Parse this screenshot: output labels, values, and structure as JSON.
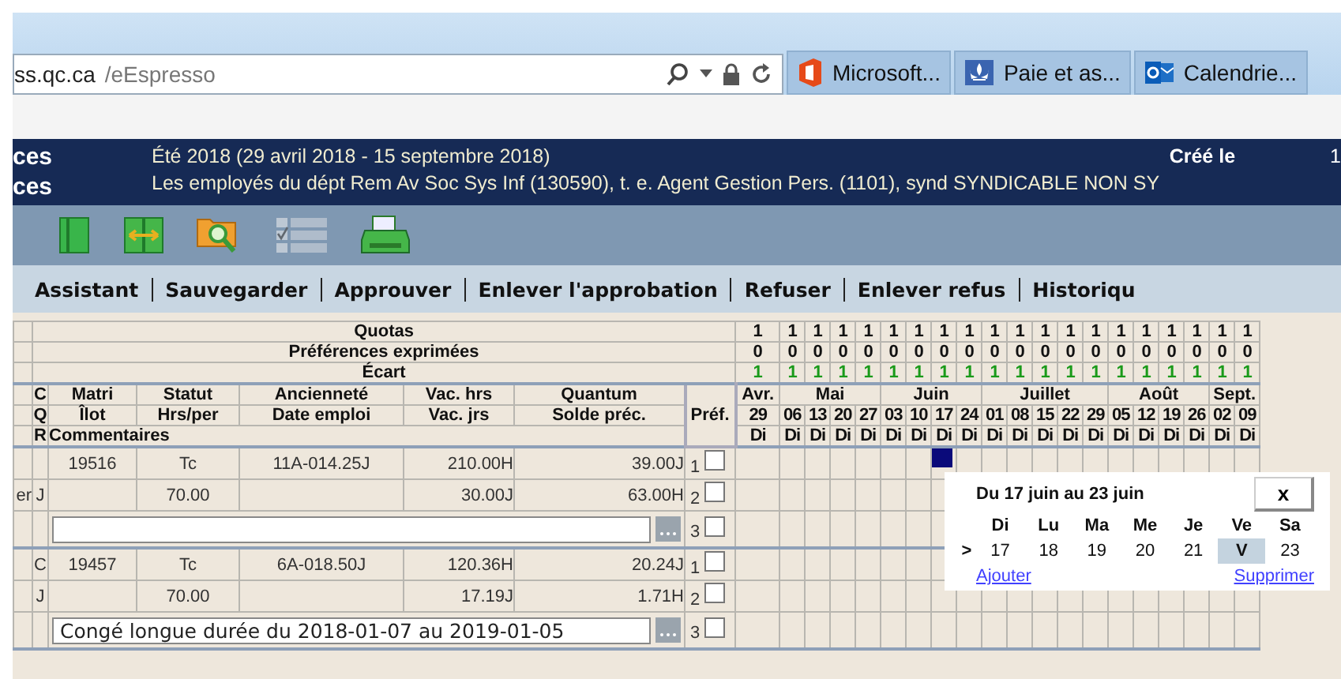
{
  "browser": {
    "address_host": "ss.qc.ca",
    "address_path": "/eEspresso",
    "tabs": [
      {
        "title": "Microsoft...",
        "kind": "office"
      },
      {
        "title": "Paie et as...",
        "kind": "fleur"
      },
      {
        "title": "Calendrie...",
        "kind": "outlook"
      }
    ]
  },
  "header": {
    "left_lines": [
      "ces",
      "ces"
    ],
    "period": "Été 2018 (29 avril 2018 - 15 septembre 2018)",
    "created_label": "Créé le",
    "created_value": "1",
    "description": "Les employés du dépt Rem Av Soc Sys Inf (130590), t. e. Agent Gestion Pers. (1101), synd SYNDICABLE NON SY"
  },
  "toolbar": [
    {
      "kind": "book",
      "disabled": false
    },
    {
      "kind": "split",
      "disabled": false
    },
    {
      "kind": "search-folder",
      "disabled": false
    },
    {
      "kind": "checklist",
      "disabled": true
    },
    {
      "kind": "printer",
      "disabled": false
    }
  ],
  "menu": [
    "Assistant",
    "Sauvegarder",
    "Approuver",
    "Enlever l'approbation",
    "Refuser",
    "Enlever refus",
    "Historiqu"
  ],
  "summary_labels": [
    "Quotas",
    "Préférences exprimées",
    "Écart"
  ],
  "columns": {
    "row1": [
      "C",
      "Matri",
      "Statut",
      "Ancienneté",
      "Vac. hrs",
      "Quantum"
    ],
    "row2": [
      "Q",
      "Îlot",
      "Hrs/per",
      "Date emploi",
      "Vac. jrs",
      "Solde préc."
    ],
    "row3": [
      "R",
      "Commentaires"
    ],
    "pref": "Préf."
  },
  "months": [
    {
      "name": "Avr.",
      "weeks": [
        {
          "date": "29",
          "day": "Di",
          "quota": "1",
          "preferences": "0",
          "ecart": "1"
        }
      ]
    },
    {
      "name": "Mai",
      "weeks": [
        {
          "date": "06",
          "day": "Di",
          "quota": "1",
          "preferences": "0",
          "ecart": "1"
        },
        {
          "date": "13",
          "day": "Di",
          "quota": "1",
          "preferences": "0",
          "ecart": "1"
        },
        {
          "date": "20",
          "day": "Di",
          "quota": "1",
          "preferences": "0",
          "ecart": "1"
        },
        {
          "date": "27",
          "day": "Di",
          "quota": "1",
          "preferences": "0",
          "ecart": "1"
        }
      ]
    },
    {
      "name": "Juin",
      "weeks": [
        {
          "date": "03",
          "day": "Di",
          "quota": "1",
          "preferences": "0",
          "ecart": "1"
        },
        {
          "date": "10",
          "day": "Di",
          "quota": "1",
          "preferences": "0",
          "ecart": "1"
        },
        {
          "date": "17",
          "day": "Di",
          "quota": "1",
          "preferences": "0",
          "ecart": "1"
        },
        {
          "date": "24",
          "day": "Di",
          "quota": "1",
          "preferences": "0",
          "ecart": "1"
        }
      ]
    },
    {
      "name": "Juillet",
      "weeks": [
        {
          "date": "01",
          "day": "Di",
          "quota": "1",
          "preferences": "0",
          "ecart": "1"
        },
        {
          "date": "08",
          "day": "Di",
          "quota": "1",
          "preferences": "0",
          "ecart": "1"
        },
        {
          "date": "15",
          "day": "Di",
          "quota": "1",
          "preferences": "0",
          "ecart": "1"
        },
        {
          "date": "22",
          "day": "Di",
          "quota": "1",
          "preferences": "0",
          "ecart": "1"
        },
        {
          "date": "29",
          "day": "Di",
          "quota": "1",
          "preferences": "0",
          "ecart": "1"
        }
      ]
    },
    {
      "name": "Août",
      "weeks": [
        {
          "date": "05",
          "day": "Di",
          "quota": "1",
          "preferences": "0",
          "ecart": "1"
        },
        {
          "date": "12",
          "day": "Di",
          "quota": "1",
          "preferences": "0",
          "ecart": "1"
        },
        {
          "date": "19",
          "day": "Di",
          "quota": "1",
          "preferences": "0",
          "ecart": "1"
        },
        {
          "date": "26",
          "day": "Di",
          "quota": "1",
          "preferences": "0",
          "ecart": "1"
        }
      ]
    },
    {
      "name": "Sept.",
      "weeks": [
        {
          "date": "02",
          "day": "Di",
          "quota": "1",
          "preferences": "0",
          "ecart": "1"
        },
        {
          "date": "09",
          "day": "Di",
          "quota": "1",
          "preferences": "0",
          "ecart": "1"
        }
      ]
    }
  ],
  "employees": [
    {
      "rows": [
        {
          "matri": "19516",
          "statut": "Tc",
          "anciennete": "11A-014.25J",
          "vac": "210.00H",
          "quantum": "39.00J"
        },
        {
          "column_1": "er",
          "code": "J",
          "statut": "70.00",
          "vac": "30.00J",
          "quantum": "63.00H"
        }
      ],
      "prefs": [
        {
          "label": "1",
          "checked": false
        },
        {
          "label": "2",
          "checked": false
        },
        {
          "label": "3",
          "checked": false
        }
      ],
      "weeks_marked": [
        false,
        false,
        false,
        false,
        false,
        false,
        false,
        true,
        false,
        false,
        false,
        false,
        false,
        false,
        false,
        false,
        false,
        false,
        false,
        false
      ]
    },
    {
      "rows": [
        {
          "code": "C",
          "matri": "19457",
          "statut": "Tc",
          "anciennete": "6A-018.50J",
          "vac": "120.36H",
          "quantum": "20.24J"
        },
        {
          "code": "J",
          "statut": "70.00",
          "vac": "17.19J",
          "quantum": "1.71H"
        }
      ],
      "comment": "Congé longue durée du 2018-01-07 au 2019-01-05",
      "prefs": [
        {
          "label": "1",
          "checked": false
        },
        {
          "label": "2",
          "checked": false
        },
        {
          "label": "3",
          "checked": false
        }
      ]
    }
  ],
  "popup": {
    "title": "Du 17 juin au 23 juin",
    "close": "x",
    "days": [
      "Di",
      "Lu",
      "Ma",
      "Me",
      "Je",
      "Ve",
      "Sa"
    ],
    "row_marker": ">",
    "dates": [
      {
        "label": "17",
        "selected": false
      },
      {
        "label": "18",
        "selected": false
      },
      {
        "label": "19",
        "selected": false
      },
      {
        "label": "20",
        "selected": false
      },
      {
        "label": "21",
        "selected": false
      },
      {
        "label": "V",
        "selected": true
      },
      {
        "label": "23",
        "selected": false
      }
    ],
    "add_link": "Ajouter",
    "delete_link": "Supprimer"
  }
}
